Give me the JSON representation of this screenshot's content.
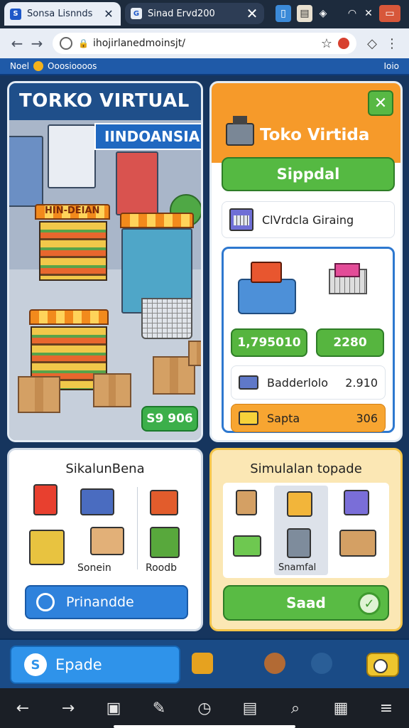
{
  "browser": {
    "tabs": [
      {
        "title": "Sonsa Lisnnds",
        "favicon": "S",
        "close": "✕"
      },
      {
        "title": "Sinad Ervd200",
        "favicon": "G",
        "close": "✕"
      }
    ],
    "url": "ihojirlanedmoinsjt/",
    "nav": {
      "back": "←",
      "forward": "→",
      "menu": "⋮"
    },
    "status_icons": [
      "wifi-icon",
      "signal-icon",
      "battery-icon"
    ]
  },
  "bookmarks": {
    "left_label": "Noel",
    "mid_label": "Ooosioooos",
    "right_label": "Ioio"
  },
  "main_panel": {
    "title": "TORKO VIRTUAL",
    "subtitle": "IINDOANSIAI",
    "sign": "HIN-DEIAN",
    "price_button": "S9 906"
  },
  "right_panel": {
    "title": "Toko Virtida",
    "close_label": "✕",
    "primary_button": "Sippdal",
    "checkout_label": "ClVrdcla Giraing",
    "left_price": "1,795010",
    "right_price": "2280",
    "row1": {
      "label": "Badderlolo",
      "value": "2.910"
    },
    "row2": {
      "label": "Sapta",
      "value": "306"
    }
  },
  "bottom_left": {
    "heading": "SikalunBena",
    "label_left": "Sonein",
    "label_right": "Roodb",
    "button": "Prinandde"
  },
  "bottom_right": {
    "heading": "Simulalan topade",
    "selected_label": "Snamfal",
    "button": "Saad"
  },
  "appbar": {
    "start_label": "Epade",
    "logo": "S"
  },
  "colors": {
    "accent_blue": "#2f82dc",
    "accent_green": "#56b53f",
    "accent_orange": "#f69a2a"
  }
}
